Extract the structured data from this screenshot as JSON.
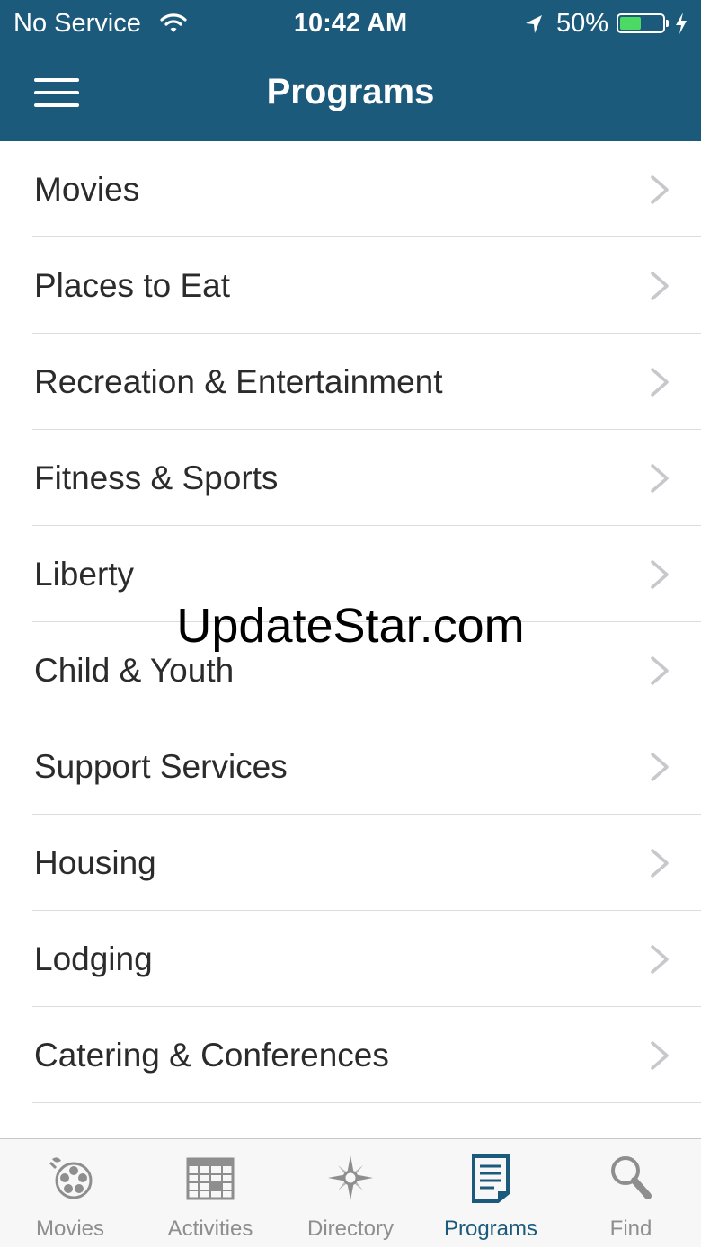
{
  "status_bar": {
    "carrier": "No Service",
    "time": "10:42 AM",
    "battery_percent": "50%",
    "battery_level": 0.5,
    "battery_color": "#4cd964"
  },
  "header": {
    "title": "Programs",
    "menu_icon": "hamburger-menu-icon",
    "background_color": "#1c5a7c"
  },
  "programs": [
    {
      "label": "Movies"
    },
    {
      "label": "Places to Eat"
    },
    {
      "label": "Recreation & Entertainment"
    },
    {
      "label": "Fitness & Sports"
    },
    {
      "label": "Liberty"
    },
    {
      "label": "Child & Youth"
    },
    {
      "label": "Support Services"
    },
    {
      "label": "Housing"
    },
    {
      "label": "Lodging"
    },
    {
      "label": "Catering & Conferences"
    }
  ],
  "watermark": "UpdateStar.com",
  "tab_bar": {
    "active_tab": "Programs",
    "active_color": "#1c5a7c",
    "tabs": [
      {
        "label": "Movies",
        "icon": "film-reel-icon"
      },
      {
        "label": "Activities",
        "icon": "calendar-icon"
      },
      {
        "label": "Directory",
        "icon": "compass-icon"
      },
      {
        "label": "Programs",
        "icon": "document-icon"
      },
      {
        "label": "Find",
        "icon": "magnifier-icon"
      }
    ]
  }
}
